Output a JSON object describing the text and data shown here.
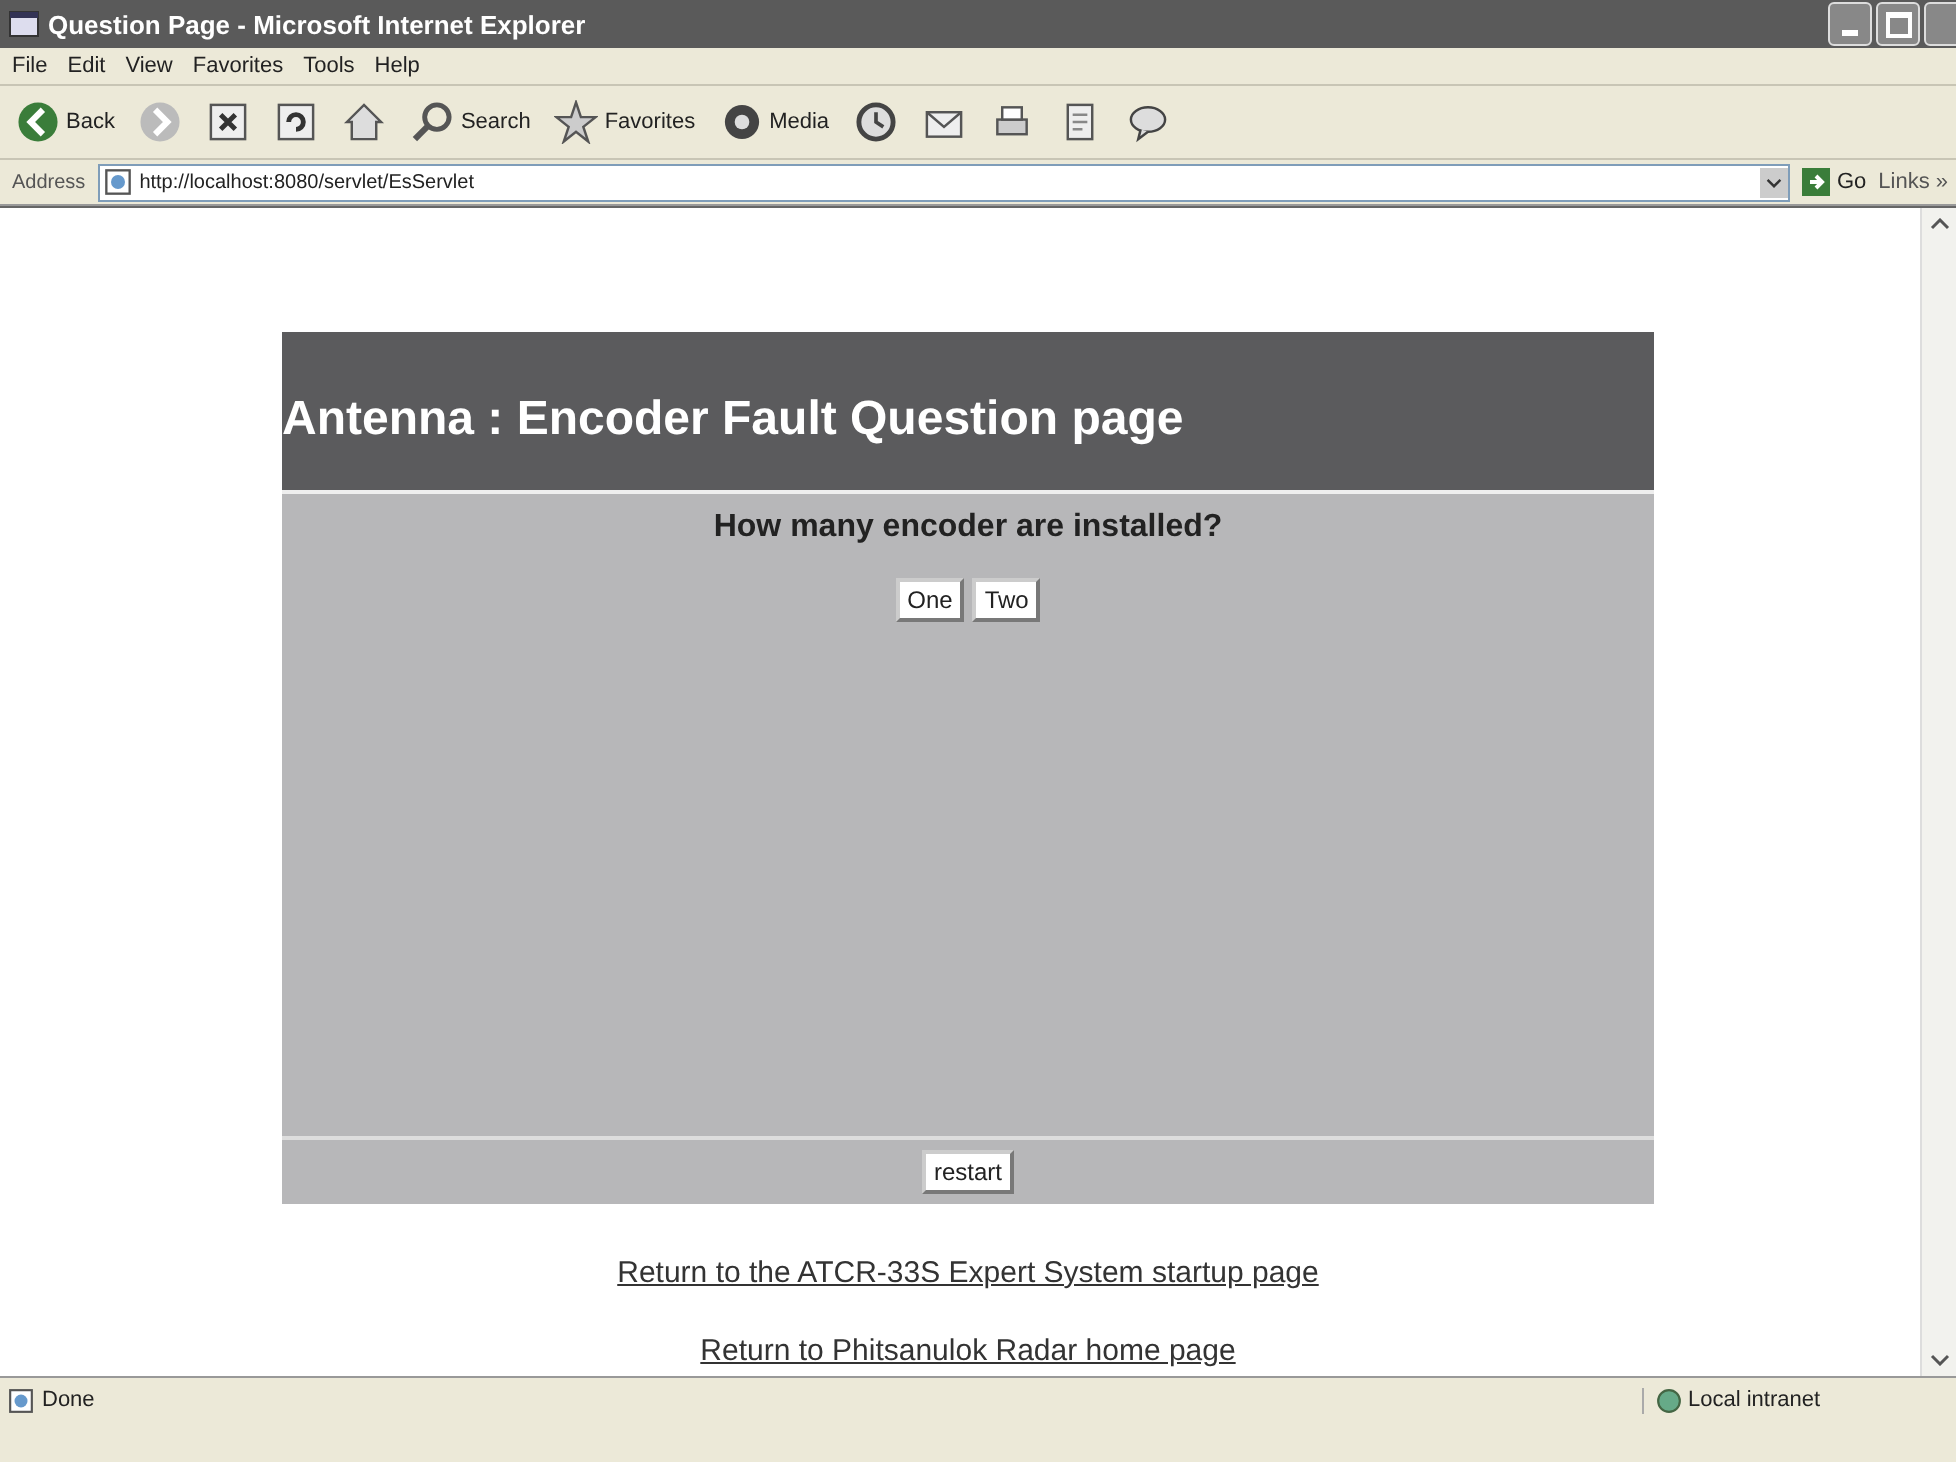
{
  "window": {
    "title": "Question Page - Microsoft Internet Explorer"
  },
  "menu": [
    "File",
    "Edit",
    "View",
    "Favorites",
    "Tools",
    "Help"
  ],
  "toolbar": [
    {
      "kind": "back",
      "label": "Back"
    },
    {
      "kind": "forward"
    },
    {
      "kind": "stop"
    },
    {
      "kind": "refresh"
    },
    {
      "kind": "home"
    },
    {
      "kind": "search",
      "label": "Search"
    },
    {
      "kind": "favorites",
      "label": "Favorites"
    },
    {
      "kind": "media",
      "label": "Media"
    },
    {
      "kind": "history"
    },
    {
      "kind": "mail"
    },
    {
      "kind": "print"
    },
    {
      "kind": "edit"
    },
    {
      "kind": "discuss"
    }
  ],
  "address": {
    "label": "Address",
    "value": "http://localhost:8080/servlet/EsServlet",
    "go": "Go",
    "links": "Links »"
  },
  "page": {
    "heading": "Antenna : Encoder Fault Question page",
    "question": "How many encoder are installed?",
    "answers": [
      "One",
      "Two"
    ],
    "restart": "restart",
    "links": [
      "Return to the ATCR-33S Expert System startup page",
      "Return to Phitsanulok Radar home page"
    ]
  },
  "status_bar": {
    "text": "Done",
    "zone": "Local intranet"
  }
}
